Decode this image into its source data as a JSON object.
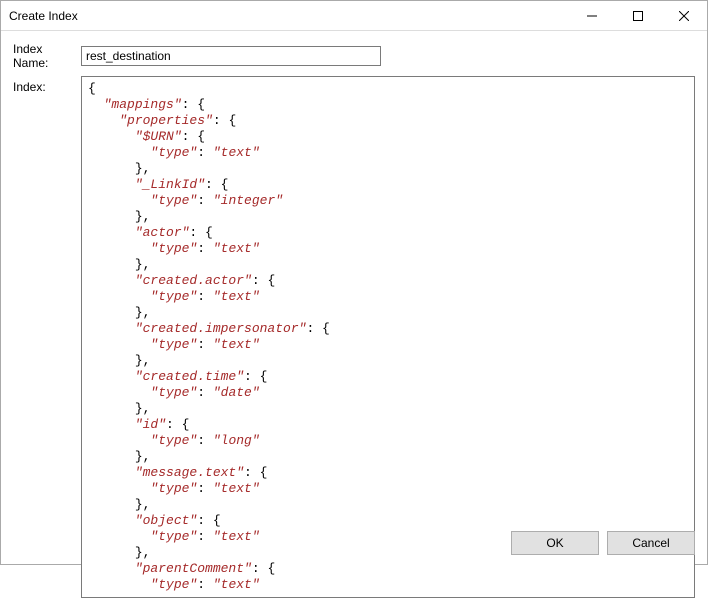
{
  "window": {
    "title": "Create Index"
  },
  "form": {
    "indexNameLabel": "Index Name:",
    "indexNameValue": "rest_destination",
    "indexLabel": "Index:"
  },
  "buttons": {
    "ok": "OK",
    "cancel": "Cancel"
  },
  "json": {
    "lines": [
      {
        "indent": 0,
        "parts": [
          {
            "t": "punct",
            "v": "{"
          }
        ]
      },
      {
        "indent": 1,
        "parts": [
          {
            "t": "key",
            "v": "\"mappings\""
          },
          {
            "t": "punct",
            "v": ": {"
          }
        ]
      },
      {
        "indent": 2,
        "parts": [
          {
            "t": "key",
            "v": "\"properties\""
          },
          {
            "t": "punct",
            "v": ": {"
          }
        ]
      },
      {
        "indent": 3,
        "parts": [
          {
            "t": "key",
            "v": "\"$URN\""
          },
          {
            "t": "punct",
            "v": ": {"
          }
        ]
      },
      {
        "indent": 4,
        "parts": [
          {
            "t": "key",
            "v": "\"type\""
          },
          {
            "t": "punct",
            "v": ": "
          },
          {
            "t": "key",
            "v": "\"text\""
          }
        ]
      },
      {
        "indent": 3,
        "parts": [
          {
            "t": "punct",
            "v": "},"
          }
        ]
      },
      {
        "indent": 3,
        "parts": [
          {
            "t": "key",
            "v": "\"_LinkId\""
          },
          {
            "t": "punct",
            "v": ": {"
          }
        ]
      },
      {
        "indent": 4,
        "parts": [
          {
            "t": "key",
            "v": "\"type\""
          },
          {
            "t": "punct",
            "v": ": "
          },
          {
            "t": "key",
            "v": "\"integer\""
          }
        ]
      },
      {
        "indent": 3,
        "parts": [
          {
            "t": "punct",
            "v": "},"
          }
        ]
      },
      {
        "indent": 3,
        "parts": [
          {
            "t": "key",
            "v": "\"actor\""
          },
          {
            "t": "punct",
            "v": ": {"
          }
        ]
      },
      {
        "indent": 4,
        "parts": [
          {
            "t": "key",
            "v": "\"type\""
          },
          {
            "t": "punct",
            "v": ": "
          },
          {
            "t": "key",
            "v": "\"text\""
          }
        ]
      },
      {
        "indent": 3,
        "parts": [
          {
            "t": "punct",
            "v": "},"
          }
        ]
      },
      {
        "indent": 3,
        "parts": [
          {
            "t": "key",
            "v": "\"created.actor\""
          },
          {
            "t": "punct",
            "v": ": {"
          }
        ]
      },
      {
        "indent": 4,
        "parts": [
          {
            "t": "key",
            "v": "\"type\""
          },
          {
            "t": "punct",
            "v": ": "
          },
          {
            "t": "key",
            "v": "\"text\""
          }
        ]
      },
      {
        "indent": 3,
        "parts": [
          {
            "t": "punct",
            "v": "},"
          }
        ]
      },
      {
        "indent": 3,
        "parts": [
          {
            "t": "key",
            "v": "\"created.impersonator\""
          },
          {
            "t": "punct",
            "v": ": {"
          }
        ]
      },
      {
        "indent": 4,
        "parts": [
          {
            "t": "key",
            "v": "\"type\""
          },
          {
            "t": "punct",
            "v": ": "
          },
          {
            "t": "key",
            "v": "\"text\""
          }
        ]
      },
      {
        "indent": 3,
        "parts": [
          {
            "t": "punct",
            "v": "},"
          }
        ]
      },
      {
        "indent": 3,
        "parts": [
          {
            "t": "key",
            "v": "\"created.time\""
          },
          {
            "t": "punct",
            "v": ": {"
          }
        ]
      },
      {
        "indent": 4,
        "parts": [
          {
            "t": "key",
            "v": "\"type\""
          },
          {
            "t": "punct",
            "v": ": "
          },
          {
            "t": "key",
            "v": "\"date\""
          }
        ]
      },
      {
        "indent": 3,
        "parts": [
          {
            "t": "punct",
            "v": "},"
          }
        ]
      },
      {
        "indent": 3,
        "parts": [
          {
            "t": "key",
            "v": "\"id\""
          },
          {
            "t": "punct",
            "v": ": {"
          }
        ]
      },
      {
        "indent": 4,
        "parts": [
          {
            "t": "key",
            "v": "\"type\""
          },
          {
            "t": "punct",
            "v": ": "
          },
          {
            "t": "key",
            "v": "\"long\""
          }
        ]
      },
      {
        "indent": 3,
        "parts": [
          {
            "t": "punct",
            "v": "},"
          }
        ]
      },
      {
        "indent": 3,
        "parts": [
          {
            "t": "key",
            "v": "\"message.text\""
          },
          {
            "t": "punct",
            "v": ": {"
          }
        ]
      },
      {
        "indent": 4,
        "parts": [
          {
            "t": "key",
            "v": "\"type\""
          },
          {
            "t": "punct",
            "v": ": "
          },
          {
            "t": "key",
            "v": "\"text\""
          }
        ]
      },
      {
        "indent": 3,
        "parts": [
          {
            "t": "punct",
            "v": "},"
          }
        ]
      },
      {
        "indent": 3,
        "parts": [
          {
            "t": "key",
            "v": "\"object\""
          },
          {
            "t": "punct",
            "v": ": {"
          }
        ]
      },
      {
        "indent": 4,
        "parts": [
          {
            "t": "key",
            "v": "\"type\""
          },
          {
            "t": "punct",
            "v": ": "
          },
          {
            "t": "key",
            "v": "\"text\""
          }
        ]
      },
      {
        "indent": 3,
        "parts": [
          {
            "t": "punct",
            "v": "},"
          }
        ]
      },
      {
        "indent": 3,
        "parts": [
          {
            "t": "key",
            "v": "\"parentComment\""
          },
          {
            "t": "punct",
            "v": ": {"
          }
        ]
      },
      {
        "indent": 4,
        "parts": [
          {
            "t": "key",
            "v": "\"type\""
          },
          {
            "t": "punct",
            "v": ": "
          },
          {
            "t": "key",
            "v": "\"text\""
          }
        ]
      }
    ]
  }
}
